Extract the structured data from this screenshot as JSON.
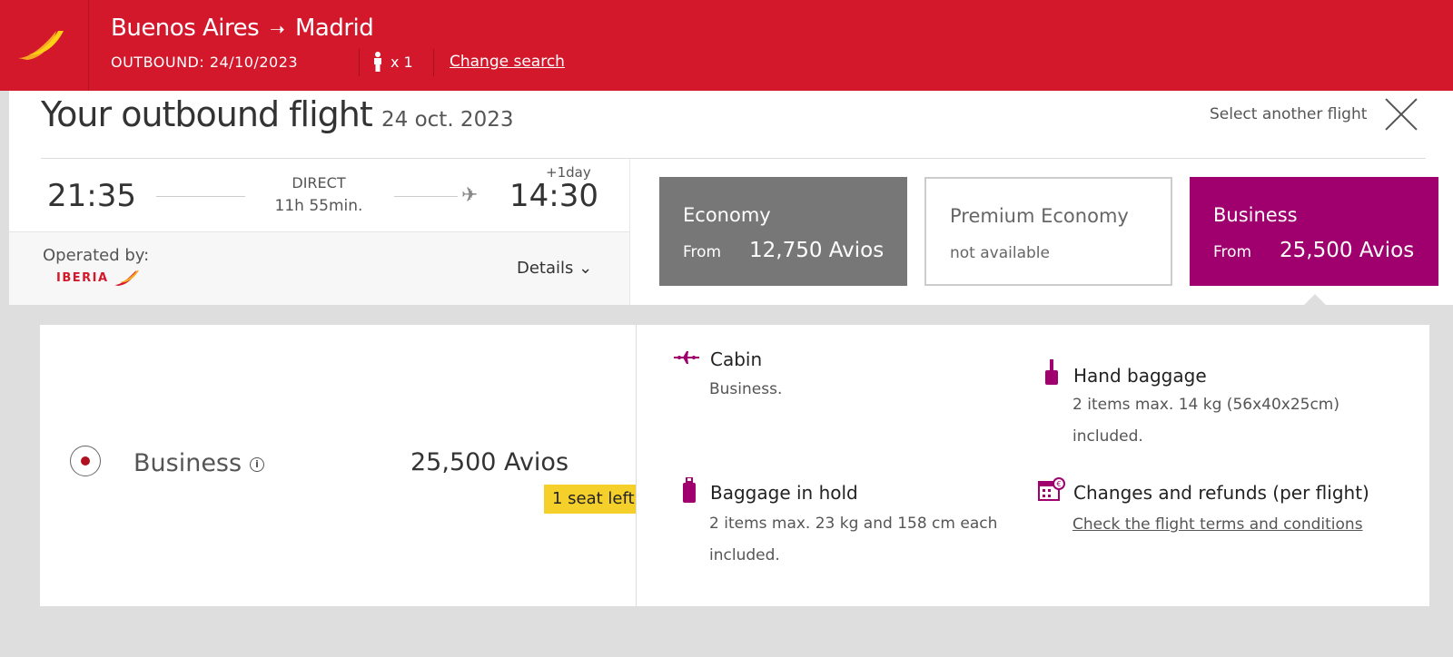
{
  "header": {
    "origin": "Buenos Aires",
    "arrow": "➝",
    "destination": "Madrid",
    "outbound": "OUTBOUND: 24/10/2023",
    "passengers": "x 1",
    "change_search": "Change search"
  },
  "flight": {
    "title": "Your outbound flight",
    "date": "24 oct. 2023",
    "select_another": "Select another flight",
    "departure_time": "21:35",
    "stops": "DIRECT",
    "duration": "11h 55min.",
    "plus_day": "+1day",
    "arrival_time": "14:30",
    "operated_by_label": "Operated by:",
    "operator": "IBERIA",
    "details_label": "Details ⌄"
  },
  "fares": {
    "economy": {
      "name": "Economy",
      "from": "From",
      "price": "12,750 Avios"
    },
    "premium": {
      "name": "Premium Economy",
      "status": "not available"
    },
    "business": {
      "name": "Business",
      "from": "From",
      "price": "25,500 Avios"
    }
  },
  "selected_fare": {
    "name": "Business",
    "price": "25,500 Avios",
    "seats_left": "1 seat left"
  },
  "features": {
    "cabin_title": "Cabin",
    "cabin_text": "Business.",
    "hand_title": "Hand baggage",
    "hand_line1": "2 items max. 14 kg (56x40x25cm)",
    "hand_line2": "included.",
    "hold_title": "Baggage in hold",
    "hold_line1": "2 items max. 23 kg and 158 cm each",
    "hold_line2": "included.",
    "changes_title": "Changes and refunds (per flight)",
    "changes_link": "Check the flight terms and conditions"
  },
  "colors": {
    "brand_red": "#d4182c",
    "business_magenta": "#a0006e",
    "economy_gray": "#777777",
    "seat_badge_yellow": "#f6d02a"
  }
}
